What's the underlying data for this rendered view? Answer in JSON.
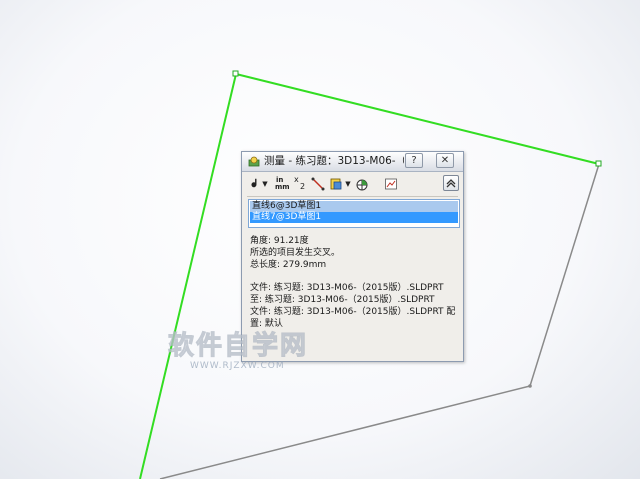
{
  "dialog": {
    "title": "测量 - 练习题：3D13-M06-（2...",
    "help_label": "?",
    "close_label": "✕",
    "toolbar": {
      "arc_label": "ᖱ",
      "units_in": "in",
      "units_mm": "mm",
      "precision_x": "x",
      "precision_2": "2"
    },
    "selections": [
      "直线6@3D草图1",
      "直线7@3D草图1"
    ],
    "results": {
      "angle": "角度: 91.21度",
      "intersect": "所选的项目发生交叉。",
      "total_length": "总长度: 279.9mm",
      "file_1": "文件:  练习题: 3D13-M06-（2015版）.SLDPRT",
      "to": "至:  练习题: 3D13-M06-（2015版）.SLDPRT",
      "file_2": "文件:  练习题: 3D13-M06-（2015版）.SLDPRT 配",
      "config": "置:  默认"
    }
  },
  "watermark": {
    "main": "软件自学网",
    "sub": "WWW.RJZXW.COM"
  },
  "colors": {
    "sketch_selected": "#33dd22",
    "sketch_line": "#888888",
    "selection_highlight": "#3399ff"
  }
}
